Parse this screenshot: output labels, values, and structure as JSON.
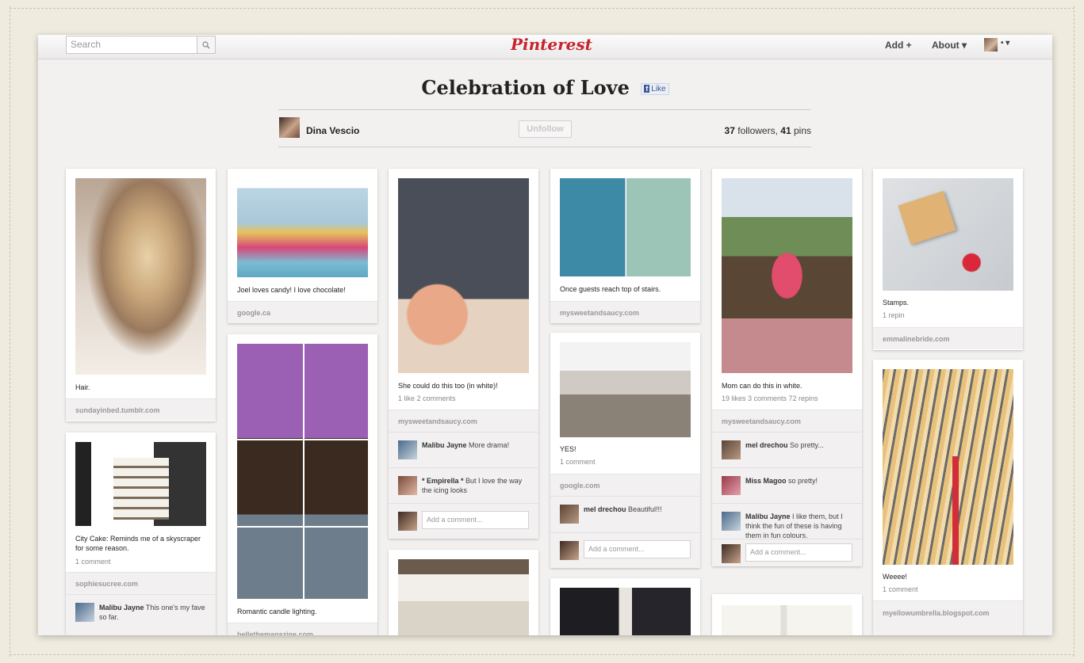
{
  "topbar": {
    "search_placeholder": "Search",
    "logo": "Pinterest",
    "add_label": "Add +",
    "about_label": "About ▾",
    "user_menu_label": "• ▾"
  },
  "board": {
    "title": "Celebration of Love",
    "fb_like": "Like",
    "owner": "Dina Vescio",
    "unfollow_label": "Unfollow",
    "followers_count": "37",
    "followers_label": "followers,",
    "pins_count": "41",
    "pins_label": "pins"
  },
  "pins": [
    {
      "caption": "Hair.",
      "source": "sundayinbed.tumblr.com"
    },
    {
      "caption": "City Cake: Reminds me of a skyscraper for some reason.",
      "meta": "1 comment",
      "source": "sophiesucree.com",
      "comment_user": "Malibu Jayne",
      "comment_text": "This one's my fave so far."
    },
    {
      "caption": "Joel loves candy! I love chocolate!",
      "source": "google.ca"
    },
    {
      "caption": "Romantic candle lighting.",
      "source": "bellethemagazine.com"
    },
    {
      "caption": "She could do this too (in white)!",
      "meta": "1 like  2 comments",
      "source": "mysweetandsaucy.com",
      "comments": [
        {
          "user": "Malibu Jayne",
          "text": "More drama!"
        },
        {
          "user": "* Empirella *",
          "text": "But I love the way the icing looks"
        }
      ],
      "add_comment": "Add a comment..."
    },
    {
      "caption": "Once guests reach top of stairs.",
      "source": "mysweetandsaucy.com"
    },
    {
      "caption": "YES!",
      "meta": "1 comment",
      "source": "google.com",
      "comments": [
        {
          "user": "mel drechou",
          "text": "Beautiful!!!"
        }
      ],
      "add_comment": "Add a comment..."
    },
    {
      "caption": "Mom can do this in white.",
      "meta": "19 likes  3 comments  72 repins",
      "source": "mysweetandsaucy.com",
      "comments": [
        {
          "user": "mel drechou",
          "text": "So pretty..."
        },
        {
          "user": "Miss Magoo",
          "text": "so pretty!"
        },
        {
          "user": "Malibu Jayne",
          "text": "I like them, but I think the fun of these is having them in fun colours."
        }
      ],
      "add_comment": "Add a comment..."
    },
    {
      "caption": "Stamps.",
      "meta": "1 repin",
      "source": "emmalinebride.com"
    },
    {
      "caption": "Weeee!",
      "meta": "1 comment",
      "source": "myellowumbrella.blogspot.com"
    }
  ],
  "colors": {
    "brand": "#c8232c",
    "page_bg": "#efebdf",
    "board_bg": "#f2f1ef"
  }
}
